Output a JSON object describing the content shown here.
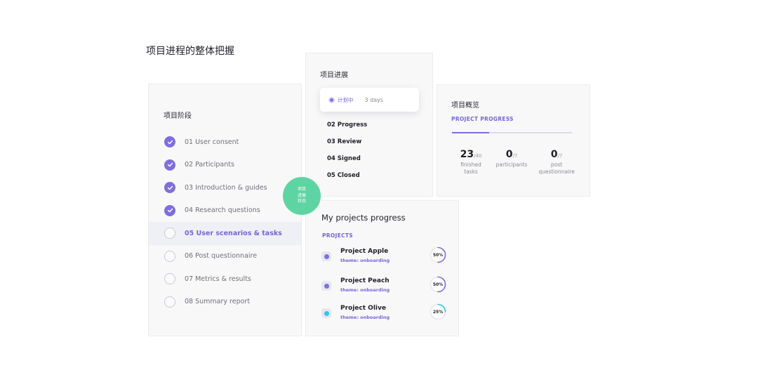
{
  "page_title": "项目进程的整体把握",
  "colors": {
    "accent": "#7d6fde",
    "badge": "#5fd4a3",
    "cyan": "#2ec6e8"
  },
  "phases": {
    "title": "项目阶段",
    "items": [
      {
        "label": "01 User consent",
        "done": true,
        "active": false
      },
      {
        "label": "02  Participants",
        "done": true,
        "active": false
      },
      {
        "label": "03  Introduction & guides",
        "done": true,
        "active": false
      },
      {
        "label": "04  Research questions",
        "done": true,
        "active": false
      },
      {
        "label": "05  User scenarios & tasks",
        "done": false,
        "active": true
      },
      {
        "label": "06  Post questionnaire",
        "done": false,
        "active": false
      },
      {
        "label": "07  Metrics & results",
        "done": false,
        "active": false
      },
      {
        "label": "08  Summary report",
        "done": false,
        "active": false
      }
    ]
  },
  "progress_card": {
    "title": "项目进展",
    "status": {
      "label": "计划中",
      "days": "3 days"
    },
    "steps": [
      "02 Progress",
      "03 Review",
      "04 Signed",
      "05 Closed"
    ]
  },
  "badge": {
    "lines": [
      "项目",
      "进展",
      "状态"
    ]
  },
  "overview": {
    "title": "项目概览",
    "subtitle": "PROJECT PROGRESS",
    "progress_fraction": 0.31,
    "stats": [
      {
        "value": "23",
        "total": "/40",
        "label_lines": [
          "finished",
          "tasks"
        ]
      },
      {
        "value": "0",
        "total": "/7",
        "label_lines": [
          "participants"
        ]
      },
      {
        "value": "0",
        "total": "/7",
        "label_lines": [
          "post",
          "questionnaire"
        ]
      }
    ]
  },
  "projects": {
    "title": "My projects progress",
    "subtitle": "PROJECTS",
    "items": [
      {
        "name": "Project Apple",
        "theme": "theme: onboarding",
        "percent": "50%",
        "fraction": 0.5,
        "color": "#7d6fde"
      },
      {
        "name": "Project Peach",
        "theme": "theme: onboarding",
        "percent": "50%",
        "fraction": 0.5,
        "color": "#7d6fde"
      },
      {
        "name": "Project Olive",
        "theme": "theme: onboarding",
        "percent": "25%",
        "fraction": 0.25,
        "color": "#2ec6e8"
      }
    ]
  }
}
